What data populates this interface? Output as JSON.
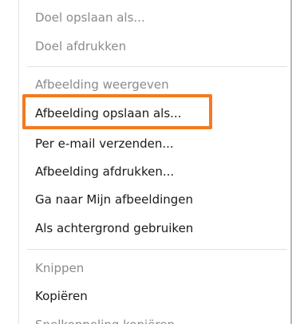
{
  "context_menu": {
    "items": [
      {
        "label": "Doel opslaan als...",
        "enabled": false
      },
      {
        "label": "Doel afdrukken",
        "enabled": false
      },
      {
        "label": "Afbeelding weergeven",
        "enabled": false
      },
      {
        "label": "Afbeelding opslaan als...",
        "enabled": true,
        "highlighted": true
      },
      {
        "label": "Per e-mail verzenden...",
        "enabled": true
      },
      {
        "label": "Afbeelding afdrukken...",
        "enabled": true
      },
      {
        "label": "Ga naar Mijn afbeeldingen",
        "enabled": true
      },
      {
        "label": "Als achtergrond gebruiken",
        "enabled": true
      },
      {
        "label": "Knippen",
        "enabled": false
      },
      {
        "label": "Kopiëren",
        "enabled": true
      },
      {
        "label": "Snelkoppeling kopiëren",
        "enabled": false
      }
    ]
  },
  "colors": {
    "highlight_border": "#f47a20",
    "text": "#1a1a1a",
    "disabled_text": "#8b8b8b"
  }
}
